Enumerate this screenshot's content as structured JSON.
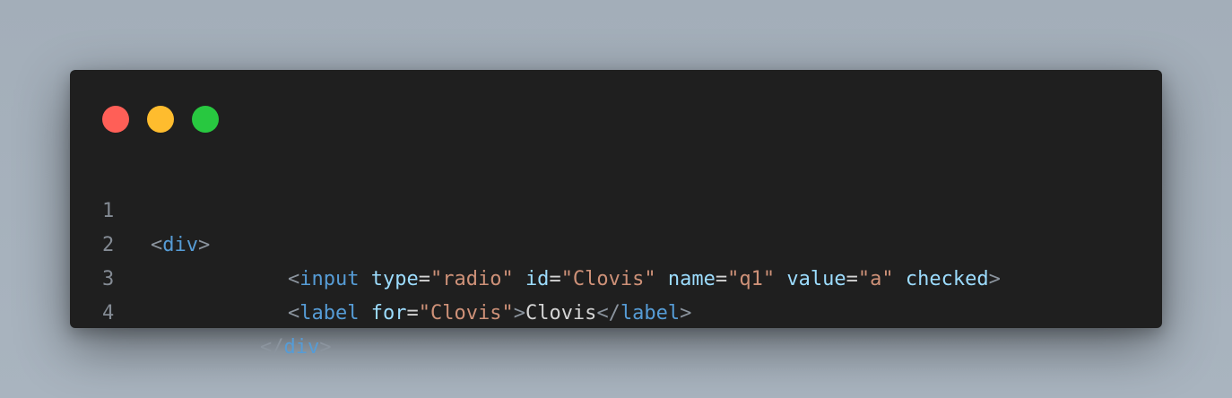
{
  "window": {
    "traffic_lights": {
      "close_color": "#ff5f57",
      "minimize_color": "#febc2e",
      "maximize_color": "#28c840"
    }
  },
  "code": {
    "lines": [
      {
        "number": "1",
        "tokens": {
          "open": "<",
          "tag": "div",
          "close": ">"
        }
      },
      {
        "number": "2",
        "tokens": {
          "open": "<",
          "tag": "input",
          "attr1": "type",
          "eq1": "=",
          "val1": "\"radio\"",
          "attr2": "id",
          "eq2": "=",
          "val2": "\"Clovis\"",
          "attr3": "name",
          "eq3": "=",
          "val3": "\"q1\"",
          "attr4": "value",
          "eq4": "=",
          "val4": "\"a\"",
          "attr5": "checked",
          "close": ">"
        }
      },
      {
        "number": "3",
        "tokens": {
          "open": "<",
          "tag": "label",
          "attr1": "for",
          "eq1": "=",
          "val1": "\"Clovis\"",
          "close": ">",
          "text": "Clovis",
          "end_open": "</",
          "end_tag": "label",
          "end_close": ">"
        }
      },
      {
        "number": "4",
        "tokens": {
          "open": "</",
          "tag": "div",
          "close": ">"
        }
      }
    ]
  }
}
